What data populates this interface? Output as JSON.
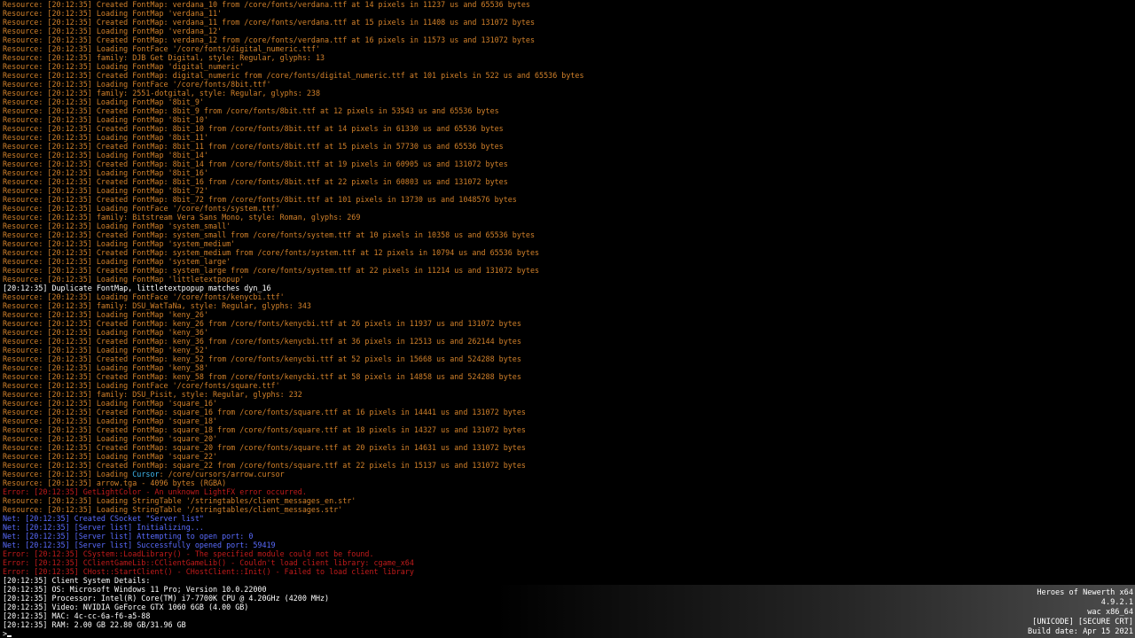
{
  "console": {
    "lines": [
      {
        "type": "resource",
        "text": "Resource: [20:12:35] Created FontMap: verdana_10 from /core/fonts/verdana.ttf at 14 pixels in 11237 us and 65536 bytes"
      },
      {
        "type": "resource",
        "text": "Resource: [20:12:35] Loading FontMap 'verdana_11'"
      },
      {
        "type": "resource",
        "text": "Resource: [20:12:35] Created FontMap: verdana_11 from /core/fonts/verdana.ttf at 15 pixels in 11408 us and 131072 bytes"
      },
      {
        "type": "resource",
        "text": "Resource: [20:12:35] Loading FontMap 'verdana_12'"
      },
      {
        "type": "resource",
        "text": "Resource: [20:12:35] Created FontMap: verdana_12 from /core/fonts/verdana.ttf at 16 pixels in 11573 us and 131072 bytes"
      },
      {
        "type": "resource",
        "text": "Resource: [20:12:35] Loading FontFace '/core/fonts/digital_numeric.ttf'"
      },
      {
        "type": "resource",
        "text": "Resource: [20:12:35] family: DJB Get Digital, style: Regular, glyphs: 13"
      },
      {
        "type": "resource",
        "text": "Resource: [20:12:35] Loading FontMap 'digital_numeric'"
      },
      {
        "type": "resource",
        "text": "Resource: [20:12:35] Created FontMap: digital_numeric from /core/fonts/digital_numeric.ttf at 101 pixels in 522 us and 65536 bytes"
      },
      {
        "type": "resource",
        "text": "Resource: [20:12:35] Loading FontFace '/core/fonts/8bit.ttf'"
      },
      {
        "type": "resource",
        "text": "Resource: [20:12:35] family: 2551-dotgital, style: Regular, glyphs: 238"
      },
      {
        "type": "resource",
        "text": "Resource: [20:12:35] Loading FontMap '8bit_9'"
      },
      {
        "type": "resource",
        "text": "Resource: [20:12:35] Created FontMap: 8bit_9 from /core/fonts/8bit.ttf at 12 pixels in 53543 us and 65536 bytes"
      },
      {
        "type": "resource",
        "text": "Resource: [20:12:35] Loading FontMap '8bit_10'"
      },
      {
        "type": "resource",
        "text": "Resource: [20:12:35] Created FontMap: 8bit_10 from /core/fonts/8bit.ttf at 14 pixels in 61330 us and 65536 bytes"
      },
      {
        "type": "resource",
        "text": "Resource: [20:12:35] Loading FontMap '8bit_11'"
      },
      {
        "type": "resource",
        "text": "Resource: [20:12:35] Created FontMap: 8bit_11 from /core/fonts/8bit.ttf at 15 pixels in 57730 us and 65536 bytes"
      },
      {
        "type": "resource",
        "text": "Resource: [20:12:35] Loading FontMap '8bit_14'"
      },
      {
        "type": "resource",
        "text": "Resource: [20:12:35] Created FontMap: 8bit_14 from /core/fonts/8bit.ttf at 19 pixels in 60905 us and 131072 bytes"
      },
      {
        "type": "resource",
        "text": "Resource: [20:12:35] Loading FontMap '8bit_16'"
      },
      {
        "type": "resource",
        "text": "Resource: [20:12:35] Created FontMap: 8bit_16 from /core/fonts/8bit.ttf at 22 pixels in 60803 us and 131072 bytes"
      },
      {
        "type": "resource",
        "text": "Resource: [20:12:35] Loading FontMap '8bit_72'"
      },
      {
        "type": "resource",
        "text": "Resource: [20:12:35] Created FontMap: 8bit_72 from /core/fonts/8bit.ttf at 101 pixels in 13730 us and 1048576 bytes"
      },
      {
        "type": "resource",
        "text": "Resource: [20:12:35] Loading FontFace '/core/fonts/system.ttf'"
      },
      {
        "type": "resource",
        "text": "Resource: [20:12:35] family: Bitstream Vera Sans Mono, style: Roman, glyphs: 269"
      },
      {
        "type": "resource",
        "text": "Resource: [20:12:35] Loading FontMap 'system_small'"
      },
      {
        "type": "resource",
        "text": "Resource: [20:12:35] Created FontMap: system_small from /core/fonts/system.ttf at 10 pixels in 10358 us and 65536 bytes"
      },
      {
        "type": "resource",
        "text": "Resource: [20:12:35] Loading FontMap 'system_medium'"
      },
      {
        "type": "resource",
        "text": "Resource: [20:12:35] Created FontMap: system_medium from /core/fonts/system.ttf at 12 pixels in 10794 us and 65536 bytes"
      },
      {
        "type": "resource",
        "text": "Resource: [20:12:35] Loading FontMap 'system_large'"
      },
      {
        "type": "resource",
        "text": "Resource: [20:12:35] Created FontMap: system_large from /core/fonts/system.ttf at 22 pixels in 11214 us and 131072 bytes"
      },
      {
        "type": "resource",
        "text": "Resource: [20:12:35] Loading FontMap 'littletextpopup'"
      },
      {
        "type": "plain",
        "text": "[20:12:35] Duplicate FontMap, littletextpopup matches dyn_16"
      },
      {
        "type": "resource",
        "text": "Resource: [20:12:35] Loading FontFace '/core/fonts/kenycbi.ttf'"
      },
      {
        "type": "resource",
        "text": "Resource: [20:12:35] family: DSU_WatTaNa, style: Regular, glyphs: 343"
      },
      {
        "type": "resource",
        "text": "Resource: [20:12:35] Loading FontMap 'keny_26'"
      },
      {
        "type": "resource",
        "text": "Resource: [20:12:35] Created FontMap: keny_26 from /core/fonts/kenycbi.ttf at 26 pixels in 11937 us and 131072 bytes"
      },
      {
        "type": "resource",
        "text": "Resource: [20:12:35] Loading FontMap 'keny_36'"
      },
      {
        "type": "resource",
        "text": "Resource: [20:12:35] Created FontMap: keny_36 from /core/fonts/kenycbi.ttf at 36 pixels in 12513 us and 262144 bytes"
      },
      {
        "type": "resource",
        "text": "Resource: [20:12:35] Loading FontMap 'keny_52'"
      },
      {
        "type": "resource",
        "text": "Resource: [20:12:35] Created FontMap: keny_52 from /core/fonts/kenycbi.ttf at 52 pixels in 15668 us and 524288 bytes"
      },
      {
        "type": "resource",
        "text": "Resource: [20:12:35] Loading FontMap 'keny_58'"
      },
      {
        "type": "resource",
        "text": "Resource: [20:12:35] Created FontMap: keny_58 from /core/fonts/kenycbi.ttf at 58 pixels in 14858 us and 524288 bytes"
      },
      {
        "type": "resource",
        "text": "Resource: [20:12:35] Loading FontFace '/core/fonts/square.ttf'"
      },
      {
        "type": "resource",
        "text": "Resource: [20:12:35] family: DSU_Pisit, style: Regular, glyphs: 232"
      },
      {
        "type": "resource",
        "text": "Resource: [20:12:35] Loading FontMap 'square_16'"
      },
      {
        "type": "resource",
        "text": "Resource: [20:12:35] Created FontMap: square_16 from /core/fonts/square.ttf at 16 pixels in 14441 us and 131072 bytes"
      },
      {
        "type": "resource",
        "text": "Resource: [20:12:35] Loading FontMap 'square_18'"
      },
      {
        "type": "resource",
        "text": "Resource: [20:12:35] Created FontMap: square_18 from /core/fonts/square.ttf at 18 pixels in 14327 us and 131072 bytes"
      },
      {
        "type": "resource",
        "text": "Resource: [20:12:35] Loading FontMap 'square_20'"
      },
      {
        "type": "resource",
        "text": "Resource: [20:12:35] Created FontMap: square_20 from /core/fonts/square.ttf at 20 pixels in 14631 us and 131072 bytes"
      },
      {
        "type": "resource",
        "text": "Resource: [20:12:35] Loading FontMap 'square_22'"
      },
      {
        "type": "resource",
        "text": "Resource: [20:12:35] Created FontMap: square_22 from /core/fonts/square.ttf at 22 pixels in 15137 us and 131072 bytes"
      },
      {
        "type": "resource",
        "text": "Resource: [20:12:35] Loading ",
        "highlight": "Cursor",
        "suffix": ": /core/cursors/arrow.cursor"
      },
      {
        "type": "resource",
        "text": "Resource: [20:12:35] arrow.tga - 4096 bytes (RGBA)"
      },
      {
        "type": "error",
        "text": "Error: [20:12:35] GetLightColor - An unknown LightFX error occurred."
      },
      {
        "type": "resource",
        "text": "Resource: [20:12:35] Loading StringTable '/stringtables/client_messages_en.str'"
      },
      {
        "type": "resource",
        "text": "Resource: [20:12:35] Loading StringTable '/stringtables/client_messages.str'"
      },
      {
        "type": "net",
        "text": "Net: [20:12:35] Created CSocket \"Server list\""
      },
      {
        "type": "net",
        "text": "Net: [20:12:35] [Server list] Initializing..."
      },
      {
        "type": "net",
        "text": "Net: [20:12:35] [Server list] Attempting to open port: 0"
      },
      {
        "type": "net",
        "text": "Net: [20:12:35] [Server list] Successfully opened port: 59419"
      },
      {
        "type": "error",
        "text": "Error: [20:12:35] CSystem::LoadLibrary() - The specified module could not be found."
      },
      {
        "type": "error",
        "text": "Error: [20:12:35] CClientGameLib::CClientGameLib() - Couldn't load client library: cgame_x64"
      },
      {
        "type": "error",
        "text": "Error: [20:12:35] CHost::StartClient() - CHostClient::Init() - Failed to load client library"
      },
      {
        "type": "plain",
        "text": "[20:12:35] Client System Details:"
      },
      {
        "type": "plain",
        "text": "[20:12:35] OS: Microsoft Windows 11 Pro; Version 10.0.22000"
      },
      {
        "type": "plain",
        "text": "[20:12:35] Processor: Intel(R) Core(TM) i7-7700K CPU @ 4.20GHz (4200 MHz)"
      },
      {
        "type": "plain",
        "text": "[20:12:35] Video: NVIDIA GeForce GTX 1060 6GB (4.00 GB)"
      },
      {
        "type": "plain",
        "text": "[20:12:35] MAC: 4c-cc-6a-f6-a5-88"
      },
      {
        "type": "plain",
        "text": "[20:12:35] RAM: 2.00 GB 22.80 GB/31.96 GB"
      }
    ],
    "prompt": ">",
    "input_value": ""
  },
  "build_info": {
    "game_name": "Heroes of Newerth x64",
    "version": "4.9.2.1",
    "platform": "wac x86_64",
    "flags": "[UNICODE] [SECURE CRT]",
    "build_date": "Build date: Apr 15 2021"
  },
  "colors": {
    "resource": "#d2812a",
    "plain": "#ffffff",
    "error": "#c21b1b",
    "net": "#5a6cff",
    "cursor_keyword": "#3fb8ef",
    "background": "#000000"
  }
}
